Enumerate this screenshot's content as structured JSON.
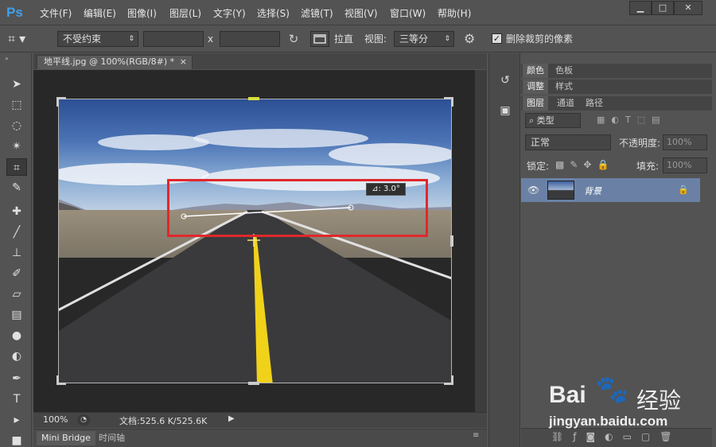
{
  "app": {
    "logo": "Ps",
    "menu": [
      "文件(F)",
      "编辑(E)",
      "图像(I)",
      "图层(L)",
      "文字(Y)",
      "选择(S)",
      "滤镜(T)",
      "视图(V)",
      "窗口(W)",
      "帮助(H)"
    ],
    "window_controls": [
      "▁",
      "□",
      "✕"
    ]
  },
  "options": {
    "ratio_select": "不受约束",
    "x_label": "x",
    "straighten_label": "拉直",
    "view_label": "视图:",
    "view_select": "三等分",
    "delete_cropped_label": "删除裁剪的像素",
    "delete_cropped_checked": true
  },
  "document": {
    "tab_title": "地平线.jpg @ 100%(RGB/8#) *",
    "tab_close": "×",
    "angle_tooltip": "⊿: 3.0°",
    "zoom": "100%",
    "doc_info": "文档:525.6 K/525.6K",
    "bottom_tabs": [
      "Mini Bridge",
      "时间轴"
    ]
  },
  "panels": {
    "color_tabs": [
      "颜色",
      "色板"
    ],
    "adjust_tabs": [
      "调整",
      "样式"
    ],
    "layer_tabs": [
      "图层",
      "通道",
      "路径"
    ],
    "filter_kind": "类型",
    "blend_mode": "正常",
    "opacity_label": "不透明度:",
    "opacity_value": "100%",
    "lock_label": "锁定:",
    "fill_label": "填充:",
    "fill_value": "100%",
    "layer_name": "背景"
  },
  "watermark": {
    "brand": "Bai",
    "brand2": "经验",
    "url": "jingyan.baidu.com"
  },
  "colors": {
    "accent_logo": "#3ba0ef",
    "highlight_red": "#e0282c",
    "selected_layer": "#6a81a5"
  }
}
